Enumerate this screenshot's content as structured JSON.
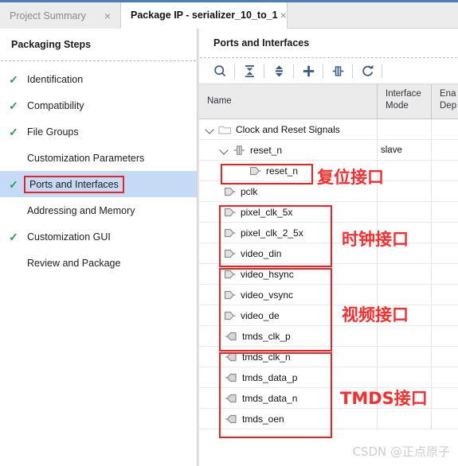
{
  "tabs": [
    {
      "label": "Project Summary",
      "active": false,
      "close": "×"
    },
    {
      "label": "Package IP - serializer_10_to_1",
      "active": true,
      "close": "×"
    }
  ],
  "left_panel": {
    "title": "Packaging Steps",
    "steps": [
      {
        "label": "Identification",
        "checked": true,
        "selected": false,
        "boxed": false
      },
      {
        "label": "Compatibility",
        "checked": true,
        "selected": false,
        "boxed": false
      },
      {
        "label": "File Groups",
        "checked": true,
        "selected": false,
        "boxed": false
      },
      {
        "label": "Customization Parameters",
        "checked": false,
        "selected": false,
        "boxed": false
      },
      {
        "label": "Ports and Interfaces",
        "checked": true,
        "selected": true,
        "boxed": true
      },
      {
        "label": "Addressing and Memory",
        "checked": false,
        "selected": false,
        "boxed": false
      },
      {
        "label": "Customization GUI",
        "checked": true,
        "selected": false,
        "boxed": false
      },
      {
        "label": "Review and Package",
        "checked": false,
        "selected": false,
        "boxed": false
      }
    ],
    "check_glyph": "✓"
  },
  "right_panel": {
    "title": "Ports and Interfaces",
    "toolbar": [
      {
        "name": "search-icon",
        "tip": "Search"
      },
      {
        "name": "collapse-all-icon",
        "tip": "Collapse All"
      },
      {
        "name": "expand-all-icon",
        "tip": "Expand All"
      },
      {
        "name": "add-icon",
        "tip": "Add"
      },
      {
        "name": "auto-infer-interface-icon",
        "tip": "Auto Infer Interface"
      },
      {
        "name": "refresh-icon",
        "tip": "Refresh"
      }
    ],
    "columns": [
      {
        "label": "Name"
      },
      {
        "label": "Interface\nMode",
        "line1": "Interface",
        "line2": "Mode"
      },
      {
        "label": "Ena\nDep",
        "line1": "Ena",
        "line2": "Dep"
      }
    ],
    "rows": [
      {
        "name": "Clock and Reset Signals",
        "indent": 0,
        "twisty": "open",
        "icon": "folder-icon",
        "mode": ""
      },
      {
        "name": "reset_n",
        "indent": 1,
        "twisty": "open",
        "icon": "bus-interface-icon",
        "mode": "slave"
      },
      {
        "name": "reset_n",
        "indent": 3,
        "twisty": "none",
        "icon": "input-port-icon",
        "mode": ""
      },
      {
        "name": "pclk",
        "indent": 1,
        "twisty": "none",
        "icon": "input-port-icon",
        "mode": ""
      },
      {
        "name": "pixel_clk_5x",
        "indent": 1,
        "twisty": "none",
        "icon": "input-port-icon",
        "mode": ""
      },
      {
        "name": "pixel_clk_2_5x",
        "indent": 1,
        "twisty": "none",
        "icon": "input-port-icon",
        "mode": ""
      },
      {
        "name": "video_din",
        "indent": 1,
        "twisty": "none",
        "icon": "input-port-icon",
        "mode": ""
      },
      {
        "name": "video_hsync",
        "indent": 1,
        "twisty": "none",
        "icon": "input-port-icon",
        "mode": ""
      },
      {
        "name": "video_vsync",
        "indent": 1,
        "twisty": "none",
        "icon": "input-port-icon",
        "mode": ""
      },
      {
        "name": "video_de",
        "indent": 1,
        "twisty": "none",
        "icon": "input-port-icon",
        "mode": ""
      },
      {
        "name": "tmds_clk_p",
        "indent": 1,
        "twisty": "none",
        "icon": "output-port-icon",
        "mode": ""
      },
      {
        "name": "tmds_clk_n",
        "indent": 1,
        "twisty": "none",
        "icon": "output-port-icon",
        "mode": ""
      },
      {
        "name": "tmds_data_p",
        "indent": 1,
        "twisty": "none",
        "icon": "output-port-icon",
        "mode": ""
      },
      {
        "name": "tmds_data_n",
        "indent": 1,
        "twisty": "none",
        "icon": "output-port-icon",
        "mode": ""
      },
      {
        "name": "tmds_oen",
        "indent": 1,
        "twisty": "none",
        "icon": "output-port-icon",
        "mode": ""
      }
    ]
  },
  "annotations": [
    {
      "text": "复位接口",
      "meaning": "reset interface"
    },
    {
      "text": "时钟接口",
      "meaning": "clock interface"
    },
    {
      "text": "视频接口",
      "meaning": "video interface"
    },
    {
      "text": "TMDS接口",
      "meaning": "TMDS interface"
    }
  ],
  "watermark": "CSDN @正点原子",
  "colors": {
    "accent": "#4a7ebb",
    "selected_row": "#c5dbf5",
    "check_green": "#22a33f",
    "annotation_red": "#f32020",
    "icon_blue": "#3d5a80"
  }
}
